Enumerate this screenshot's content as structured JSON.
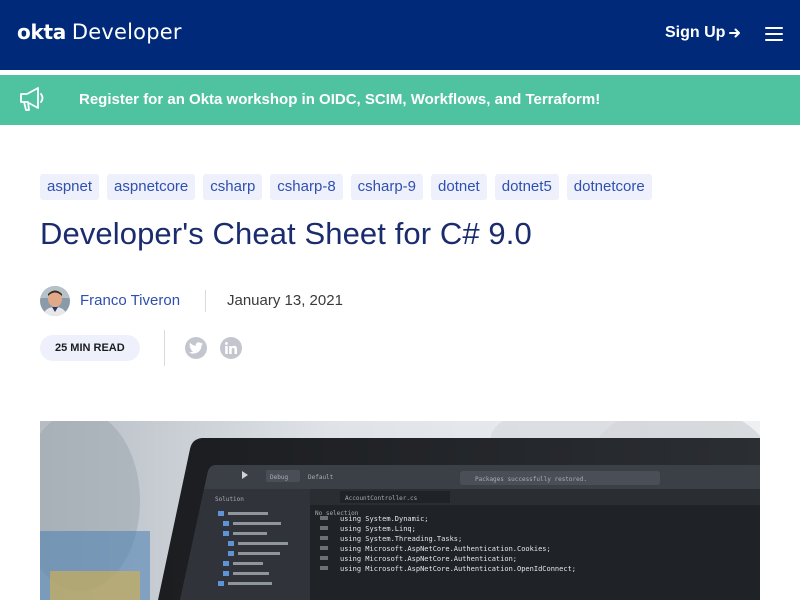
{
  "header": {
    "logo_brand": "okta",
    "logo_product": "Developer",
    "signup_label": "Sign Up",
    "colors": {
      "background": "#00297a",
      "text": "#ffffff"
    }
  },
  "banner": {
    "text": "Register for an Okta workshop in OIDC, SCIM, Workflows, and Terraform!",
    "icon": "megaphone-icon",
    "color": "#4fc2a0"
  },
  "post": {
    "tags": [
      "aspnet",
      "aspnetcore",
      "csharp",
      "csharp-8",
      "csharp-9",
      "dotnet",
      "dotnet5",
      "dotnetcore"
    ],
    "title": "Developer's Cheat Sheet for C# 9.0",
    "author": "Franco Tiveron",
    "date": "January 13, 2021",
    "read_time": "25 MIN READ",
    "share_icons": [
      "twitter-icon",
      "linkedin-icon"
    ]
  },
  "hero_code_lines": [
    "using System.Dynamic;",
    "using System.Linq;",
    "using System.Threading.Tasks;",
    "using Microsoft.AspNetCore.Authentication.Cookies;",
    "using Microsoft.AspNetCore.Authentication;",
    "using Microsoft.AspNetCore.Authentication.OpenIdConnect;"
  ],
  "hero_ui": {
    "file_tab": "AccountController.cs",
    "status": "Packages successfully restored.",
    "no_selection": "No selection",
    "debug": "Debug",
    "default": "Default",
    "solution": "Solution"
  }
}
